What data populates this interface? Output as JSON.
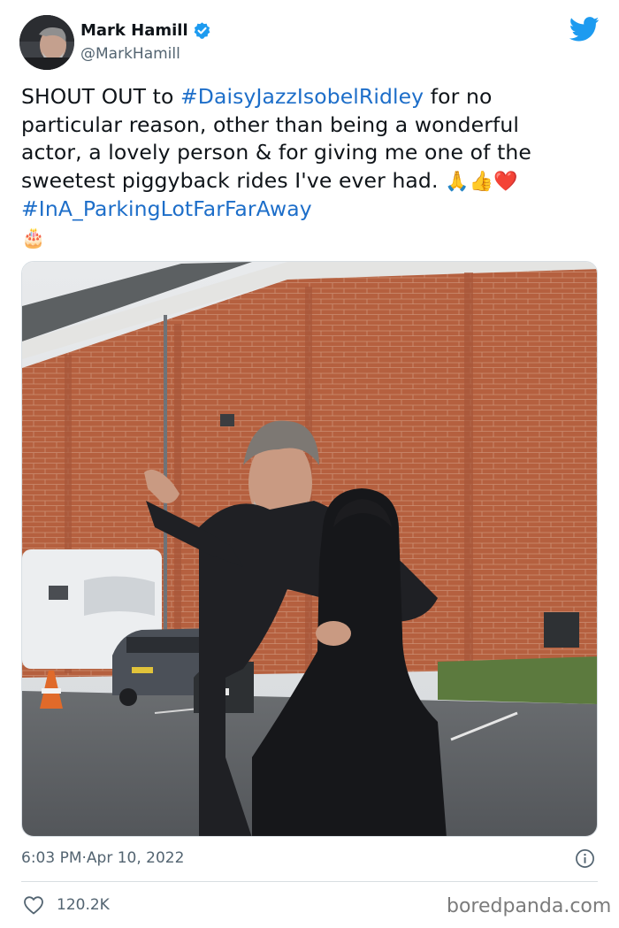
{
  "author": {
    "display_name": "Mark Hamill",
    "handle": "@MarkHamill",
    "verified": true,
    "avatar_icon": "avatar-photo"
  },
  "platform_icon": "twitter-bird-icon",
  "tweet": {
    "lines": [
      [
        {
          "t": "SHOUT OUT to ",
          "tag": false
        },
        {
          "t": "#DaisyJazzIsobelRidley",
          "tag": true
        },
        {
          "t": " for no",
          "tag": false
        }
      ],
      [
        {
          "t": "particular reason, other than being a wonderful",
          "tag": false
        }
      ],
      [
        {
          "t": "actor, a lovely person & for giving me one of the",
          "tag": false
        }
      ],
      [
        {
          "t": "sweetest piggyback rides I've ever had. ",
          "tag": false
        },
        {
          "t": "🙏👍❤️",
          "tag": false,
          "emoji": true
        }
      ],
      [
        {
          "t": " #InA_ParkingLotFarFarAway",
          "tag": true
        }
      ],
      [
        {
          "t": "🎂",
          "tag": false,
          "emoji": true
        }
      ]
    ]
  },
  "meta": {
    "time": "6:03 PM",
    "separator": " · ",
    "date": "Apr 10, 2022"
  },
  "engagement": {
    "likes": "120.2K"
  },
  "watermark": "boredpanda.com",
  "colors": {
    "hashtag": "#1d6ec9",
    "twitter_blue": "#1d9bf0",
    "muted": "#536471"
  }
}
